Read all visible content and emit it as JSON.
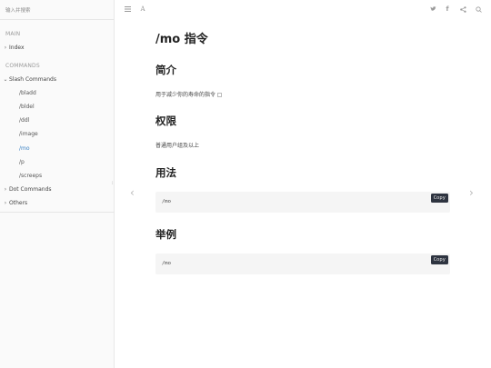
{
  "sidebar": {
    "search_placeholder": "输入并搜索",
    "sections": {
      "main": "MAIN",
      "commands": "COMMANDS"
    },
    "items": {
      "index": "Index",
      "slash_commands": "Slash Commands",
      "dot_commands": "Dot Commands",
      "others": "Others"
    },
    "sub_items": [
      "/bladd",
      "/bldel",
      "/ddl",
      "/image",
      "/mo",
      "/p",
      "/screeps"
    ],
    "active_item": "/mo"
  },
  "toolbar": {
    "menu_icon": "menu-icon",
    "font_icon_label": "A",
    "icons": [
      "twitter-icon",
      "facebook-icon",
      "share-icon",
      "search-icon"
    ]
  },
  "page": {
    "title": "/mo 指令",
    "sections": [
      {
        "heading": "简介",
        "text": "用于减少你的寿命的指令"
      },
      {
        "heading": "权限",
        "text": "普通用户组及以上"
      },
      {
        "heading": "用法",
        "code": "/mo"
      },
      {
        "heading": "举例",
        "code": "/mo"
      }
    ],
    "copy_label": "Copy"
  },
  "nav": {
    "prev_icon": "chevron-left-icon",
    "next_icon": "chevron-right-icon"
  }
}
